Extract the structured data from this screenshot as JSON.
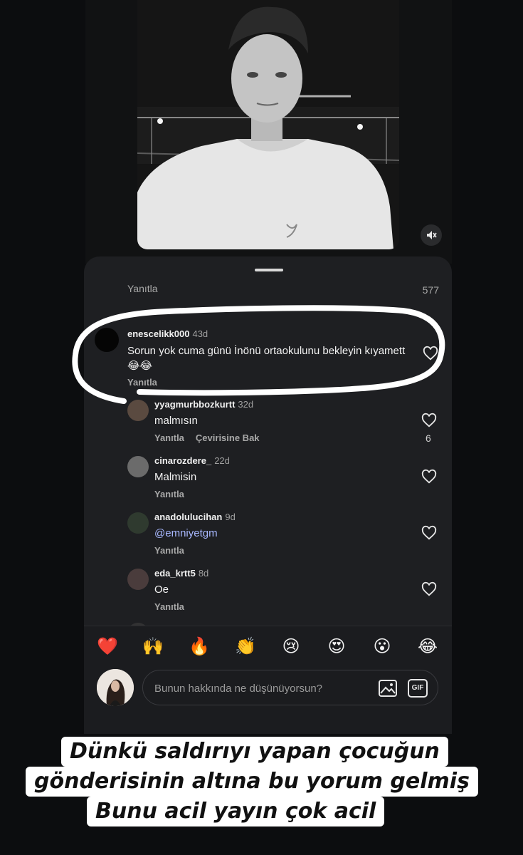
{
  "comments": {
    "top_reply_label": "Yanıtla",
    "top_count": "577",
    "items": [
      {
        "username": "enescelikk000",
        "ago": "43d",
        "text": "Sorun yok cuma günü İnönü ortaokulunu bekleyin kıyamett😂😂",
        "reply": "Yanıtla"
      },
      {
        "username": "yyagmurbbozkurtt",
        "ago": "32d",
        "text": "malmısın",
        "reply": "Yanıtla",
        "translate": "Çevirisine Bak",
        "likes": "6"
      },
      {
        "username": "cinarozdere_",
        "ago": "22d",
        "text": "Malmisin",
        "reply": "Yanıtla"
      },
      {
        "username": "anadolulucihan",
        "ago": "9d",
        "text": "@emniyetgm",
        "reply": "Yanıtla"
      },
      {
        "username": "eda_krtt5",
        "ago": "8d",
        "text": "Oe",
        "reply": "Yanıtla"
      }
    ]
  },
  "reactions": [
    "❤️",
    "🙌",
    "🔥",
    "👏",
    "😢",
    "😍",
    "😮",
    "😂"
  ],
  "input": {
    "placeholder": "Bunun hakkında ne düşünüyorsun?",
    "gif_label": "GIF"
  },
  "caption": [
    "Dünkü saldırıyı yapan çocuğun",
    "gönderisinin altına bu yorum gelmiş",
    "Bunu acil yayın çok acil"
  ],
  "colors": {
    "sheet_bg": "#1e1f22",
    "mention": "#a8b8ff",
    "highlight_circle": "#ffffff"
  }
}
